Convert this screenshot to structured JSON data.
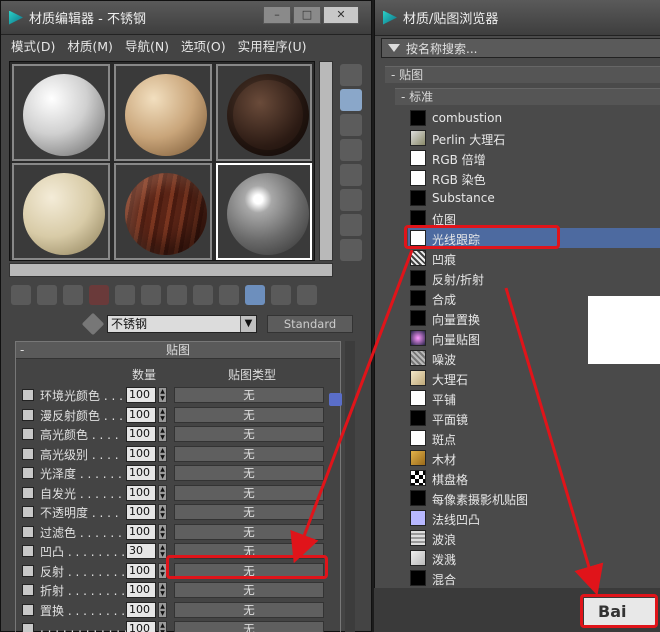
{
  "left_window": {
    "title": "材质编辑器 - 不锈钢",
    "menu": [
      "模式(D)",
      "材质(M)",
      "导航(N)",
      "选项(O)",
      "实用程序(U)"
    ],
    "material_name": "不锈钢",
    "material_type": "Standard",
    "rollout_title": "贴图",
    "col_amount": "数量",
    "col_maptype": "贴图类型",
    "map_rows": [
      {
        "label": "环境光颜色 . . .",
        "amount": "100",
        "map": "无"
      },
      {
        "label": "漫反射颜色 . . .",
        "amount": "100",
        "map": "无"
      },
      {
        "label": "高光颜色 . . . .",
        "amount": "100",
        "map": "无"
      },
      {
        "label": "高光级别 . . . .",
        "amount": "100",
        "map": "无"
      },
      {
        "label": "光泽度 . . . . . .",
        "amount": "100",
        "map": "无"
      },
      {
        "label": "自发光 . . . . . .",
        "amount": "100",
        "map": "无"
      },
      {
        "label": "不透明度 . . . .",
        "amount": "100",
        "map": "无"
      },
      {
        "label": "过滤色 . . . . . .",
        "amount": "100",
        "map": "无"
      },
      {
        "label": "凹凸 . . . . . . . .",
        "amount": "30",
        "map": "无"
      },
      {
        "label": "反射 . . . . . . . .",
        "amount": "100",
        "map": "无"
      },
      {
        "label": "折射 . . . . . . . .",
        "amount": "100",
        "map": "无"
      },
      {
        "label": "置换 . . . . . . . .",
        "amount": "100",
        "map": "无"
      },
      {
        "label": ". . . . . . . . . . . .",
        "amount": "100",
        "map": "无"
      }
    ]
  },
  "right_window": {
    "title": "材质/贴图浏览器",
    "search_placeholder": "按名称搜索...",
    "group_maps": "- 贴图",
    "group_standard": "- 标准",
    "maps": [
      "combustion",
      "Perlin 大理石",
      "RGB 倍增",
      "RGB 染色",
      "Substance",
      "位图",
      "光线跟踪",
      "凹痕",
      "反射/折射",
      "合成",
      "向量置换",
      "向量贴图",
      "噪波",
      "大理石",
      "平铺",
      "平面镜",
      "斑点",
      "木材",
      "棋盘格",
      "每像素摄影机贴图",
      "法线凹凸",
      "波浪",
      "泼溅",
      "混合"
    ],
    "selected_map": "光线跟踪",
    "ok_label": "Bai"
  },
  "colors": {
    "annotation": "#e0141a",
    "selection": "#4d6aa0"
  }
}
